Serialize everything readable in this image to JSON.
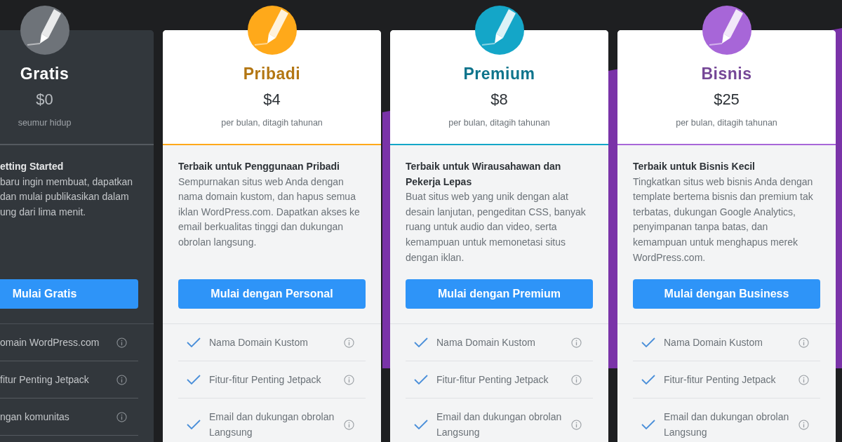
{
  "plans": [
    {
      "kind": "free",
      "name": "Gratis",
      "color": "#6e7379",
      "price": "$0",
      "period": "seumur hidup",
      "heading": "etting Started",
      "description_lines": [
        "baru ingin membuat, dapatkan",
        "dan mulai publikasikan dalam",
        "ung dari lima menit."
      ],
      "button": "Mulai Gratis",
      "features": [
        {
          "text": "omain WordPress.com"
        },
        {
          "text": "fitur Penting Jetpack"
        },
        {
          "text": "ngan komunitas"
        }
      ]
    },
    {
      "kind": "paid",
      "name": "Pribadi",
      "color": "#ffa91a",
      "price": "$4",
      "period": "per bulan, ditagih tahunan",
      "heading": "Terbaik untuk Penggunaan Pribadi",
      "description": "Sempurnakan situs web Anda dengan nama domain kustom, dan hapus semua iklan WordPress.com. Dapatkan akses ke email berkualitas tinggi dan dukungan obrolan langsung.",
      "button": "Mulai dengan Personal",
      "features": [
        {
          "text": "Nama Domain Kustom"
        },
        {
          "text": "Fitur-fitur Penting Jetpack"
        },
        {
          "text": "Email dan dukungan obrolan Langsung"
        }
      ]
    },
    {
      "kind": "paid",
      "name": "Premium",
      "color": "#14a6c8",
      "price": "$8",
      "period": "per bulan, ditagih tahunan",
      "heading": "Terbaik untuk Wirausahawan dan Pekerja Lepas",
      "description": "Buat situs web yang unik dengan alat desain lanjutan, pengeditan CSS, banyak ruang untuk audio dan video, serta kemampuan untuk memonetasi situs dengan iklan.",
      "button": "Mulai dengan Premium",
      "features": [
        {
          "text": "Nama Domain Kustom"
        },
        {
          "text": "Fitur-fitur Penting Jetpack"
        },
        {
          "text": "Email dan dukungan obrolan Langsung"
        }
      ]
    },
    {
      "kind": "paid",
      "name": "Bisnis",
      "color": "#a766d8",
      "price": "$25",
      "period": "per bulan, ditagih tahunan",
      "heading": "Terbaik untuk Bisnis Kecil",
      "description": "Tingkatkan situs web bisnis Anda dengan template bertema bisnis dan premium tak terbatas, dukungan Google Analytics, penyimpanan tanpa batas, dan kemampuan untuk menghapus merek WordPress.com.",
      "button": "Mulai dengan Business",
      "features": [
        {
          "text": "Nama Domain Kustom"
        },
        {
          "text": "Fitur-fitur Penting Jetpack"
        },
        {
          "text": "Email dan dukungan obrolan Langsung"
        }
      ]
    }
  ]
}
